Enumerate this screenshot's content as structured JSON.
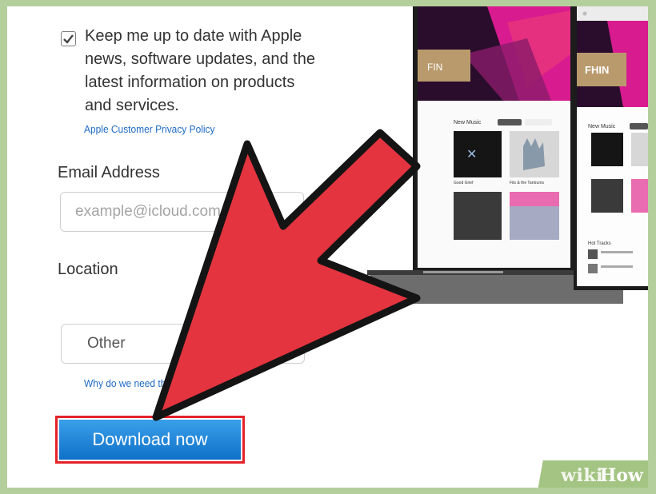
{
  "signup": {
    "newsletter_checked": true,
    "newsletter_text": "Keep me up to date with Apple news, software updates, and the latest information on products and services.",
    "privacy_link": "Apple Customer Privacy Policy",
    "email_label": "Email Address",
    "email_placeholder": "example@icloud.com",
    "location_label": "Location",
    "location_value": "Other",
    "why_link": "Why do we need this?",
    "download_label": "Download now"
  },
  "promo_screens": {
    "left_title": "FIN",
    "right_title": "FHIN",
    "new_music_label": "New Music",
    "hot_tracks_label": "Hot Tracks",
    "album1": "Good Grief",
    "album2": "Fits & the Tantrums"
  },
  "watermark": {
    "wiki": "wiki",
    "how": "How"
  },
  "colors": {
    "accent_red": "#e4222a",
    "button_blue": "#1683d8",
    "link_blue": "#1e6bc4",
    "page_bg": "#b5cf9c"
  }
}
